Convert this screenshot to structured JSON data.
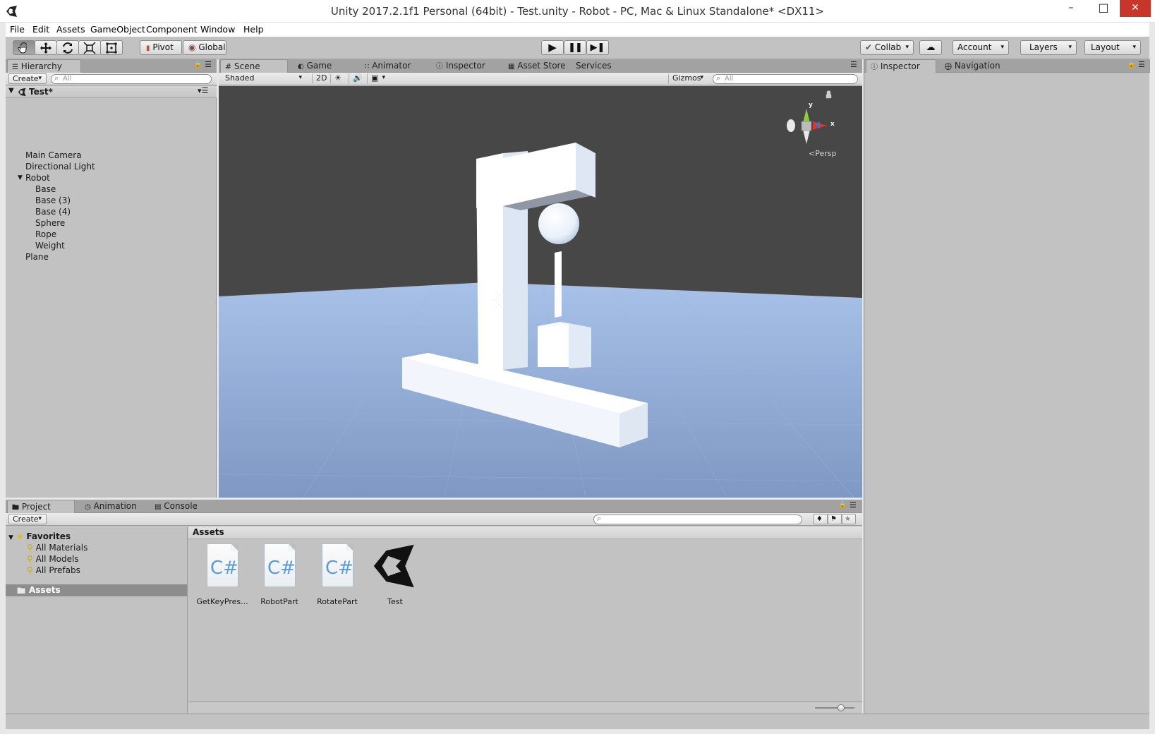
{
  "window": {
    "title": "Unity 2017.2.1f1 Personal (64bit) - Test.unity - Robot - PC, Mac & Linux Standalone* <DX11>",
    "min_symbol": "–",
    "max_symbol": "□",
    "close_symbol": "✕"
  },
  "menu": [
    "File",
    "Edit",
    "Assets",
    "GameObject",
    "Component",
    "Window",
    "Help"
  ],
  "toolbar": {
    "tools": [
      "hand-tool",
      "move-tool",
      "rotate-tool",
      "scale-tool",
      "rect-tool"
    ],
    "pivot_label": "Pivot",
    "global_label": "Global",
    "collab_label": "Collab",
    "account_label": "Account",
    "layers_label": "Layers",
    "layout_label": "Layout"
  },
  "hierarchy": {
    "tab_label": "Hierarchy",
    "create_label": "Create",
    "search_placeholder": "All",
    "scene_name": "Test*",
    "items": [
      {
        "label": "Main Camera"
      },
      {
        "label": "Directional Light"
      },
      {
        "label": "Robot"
      },
      {
        "label": "Base"
      },
      {
        "label": "Base (3)"
      },
      {
        "label": "Base (4)"
      },
      {
        "label": "Sphere"
      },
      {
        "label": "Rope"
      },
      {
        "label": "Weight"
      },
      {
        "label": "Plane"
      }
    ]
  },
  "scene_tabs": [
    "Scene",
    "Game",
    "Animator",
    "Inspector",
    "Asset Store",
    "Services"
  ],
  "scene_toolbar": {
    "shading_mode": "Shaded",
    "mode_2d": "2D",
    "gizmos_label": "Gizmos",
    "search_placeholder": "All"
  },
  "gizmo": {
    "y_label": "y",
    "x_label": "x",
    "projection_label": "Persp",
    "colors": {
      "y": "#8ccf3c",
      "x": "#d9362c",
      "z": "#3d6fd8"
    }
  },
  "right_tabs": [
    "Inspector",
    "Navigation"
  ],
  "bottom_tabs": [
    "Project",
    "Animation",
    "Console"
  ],
  "project": {
    "create_label": "Create",
    "favorites_label": "Favorites",
    "favorites": [
      "All Materials",
      "All Models",
      "All Prefabs"
    ],
    "assets_root": "Assets",
    "breadcrumb": "Assets",
    "assets": [
      {
        "label": "GetKeyPres...",
        "kind": "cs"
      },
      {
        "label": "RobotPart",
        "kind": "cs"
      },
      {
        "label": "RotatePart",
        "kind": "cs"
      },
      {
        "label": "Test",
        "kind": "unity-scene"
      }
    ],
    "cs_glyph": "C#"
  },
  "colors": {
    "panel_bg": "#c2c2c2",
    "scene_sky": "#474747",
    "ground_near": "#7f98c3",
    "ground_far": "#a7c1e8",
    "close_red": "#c7352b"
  }
}
